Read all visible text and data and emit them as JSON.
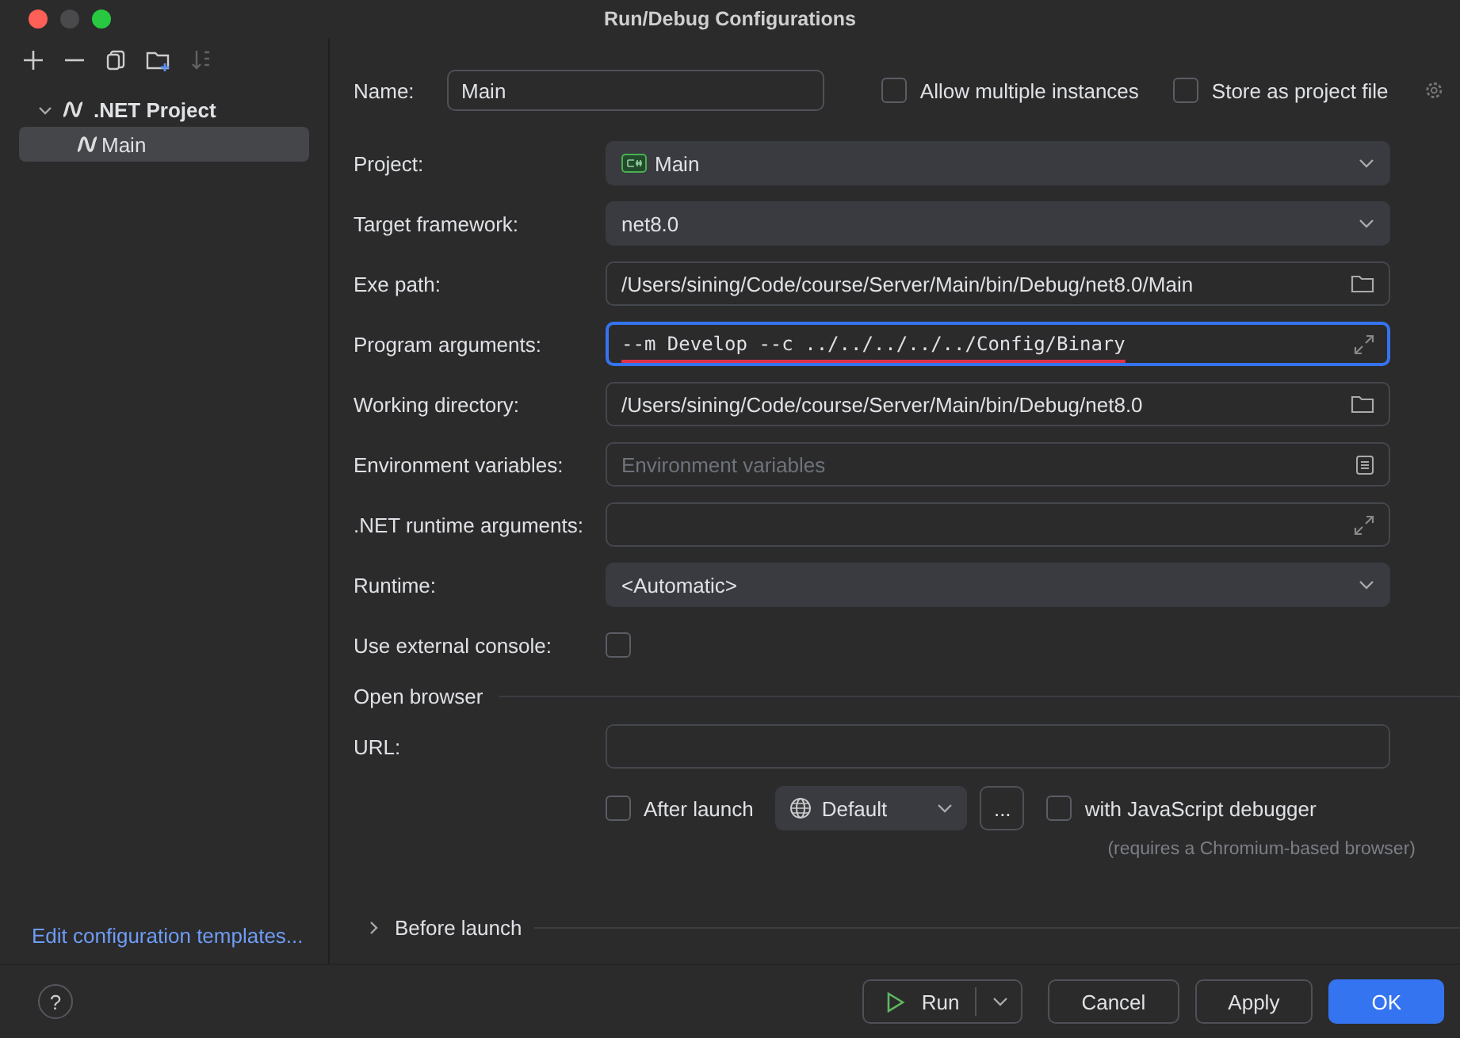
{
  "window": {
    "title": "Run/Debug Configurations"
  },
  "toolbar": {
    "items": [
      {
        "kind": "add"
      },
      {
        "kind": "remove"
      },
      {
        "kind": "copy"
      },
      {
        "kind": "folder"
      },
      {
        "kind": "sort",
        "disabled": true
      }
    ]
  },
  "tree": [
    {
      "label": ".NET Project",
      "expanded": true,
      "selected": false,
      "children": [
        {
          "label": "Main",
          "selected": true
        }
      ]
    }
  ],
  "edit_templates_link": "Edit configuration templates...",
  "name": {
    "label": "Name:",
    "value": "Main"
  },
  "header_checkboxes": [
    {
      "label": "Allow multiple instances",
      "checked": false
    },
    {
      "label": "Store as project file",
      "checked": false
    }
  ],
  "fields": [
    {
      "label": "Project:",
      "kind": "project",
      "value": "Main"
    },
    {
      "label": "Target framework:",
      "kind": "dropdown",
      "value": "net8.0"
    },
    {
      "label": "Exe path:",
      "kind": "path",
      "value": "/Users/sining/Code/course/Server/Main/bin/Debug/net8.0/Main"
    },
    {
      "label": "Program arguments:",
      "kind": "expand",
      "value": "--m Develop --c ../../../../../Config/Binary",
      "focused": true,
      "monospace": true,
      "underlined": true
    },
    {
      "label": "Working directory:",
      "kind": "path",
      "value": "/Users/sining/Code/course/Server/Main/bin/Debug/net8.0"
    },
    {
      "label": "Environment variables:",
      "kind": "list",
      "placeholder": "Environment variables"
    },
    {
      "label": ".NET runtime arguments:",
      "kind": "expand"
    },
    {
      "label": "Runtime:",
      "kind": "dropdown",
      "value": "<Automatic>"
    },
    {
      "label": "Use external console:",
      "kind": "checkbox",
      "checked": false
    }
  ],
  "open_browser": {
    "title": "Open browser",
    "url_label": "URL:",
    "after_launch": {
      "label": "After launch",
      "checked": false
    },
    "browser": "Default",
    "more_button": "...",
    "js_debugger": {
      "label": "with JavaScript debugger",
      "checked": false
    },
    "note": "(requires a Chromium-based browser)"
  },
  "before_launch": {
    "label": "Before launch",
    "expanded": false
  },
  "help_button": "?",
  "buttons": [
    {
      "label": "Run",
      "kind": "split"
    },
    {
      "label": "Cancel",
      "kind": "normal"
    },
    {
      "label": "Apply",
      "kind": "normal"
    },
    {
      "label": "OK",
      "kind": "primary"
    }
  ]
}
